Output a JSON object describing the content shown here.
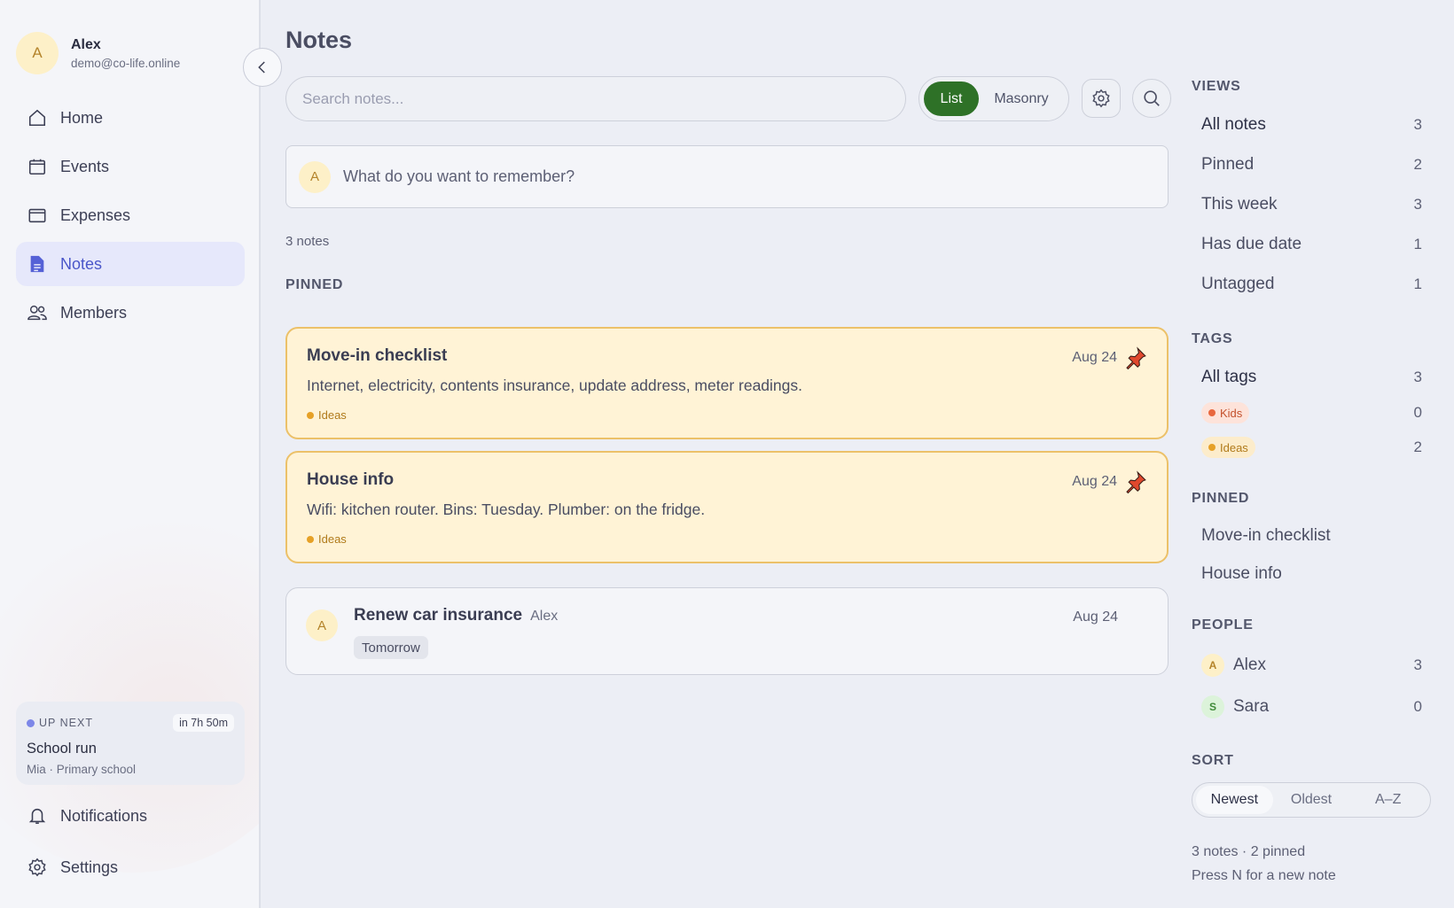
{
  "profile": {
    "initial": "A",
    "name": "Alex",
    "email": "demo@co-life.online"
  },
  "nav": {
    "items": [
      {
        "label": "Home",
        "icon": "home-icon"
      },
      {
        "label": "Events",
        "icon": "calendar-icon"
      },
      {
        "label": "Expenses",
        "icon": "wallet-icon"
      },
      {
        "label": "Notes",
        "icon": "note-icon",
        "active": true
      },
      {
        "label": "Members",
        "icon": "members-icon"
      }
    ],
    "bottom": [
      {
        "label": "Notifications",
        "icon": "bell-icon"
      },
      {
        "label": "Settings",
        "icon": "gear-icon"
      }
    ]
  },
  "up_next": {
    "label": "UP NEXT",
    "time": "in 7h 50m",
    "title": "School run",
    "subtitle": "Mia · Primary school"
  },
  "main": {
    "title": "Notes",
    "search_placeholder": "Search notes...",
    "view_toggle": {
      "active": "List",
      "inactive": "Masonry"
    },
    "composer": {
      "initial": "A",
      "placeholder": "What do you want to remember?"
    },
    "count_text": "3 notes",
    "pinned_label": "PINNED",
    "pinned_notes": [
      {
        "title": "Move-in checklist",
        "date": "Aug 24",
        "body": "Internet, electricity, contents insurance, update address, meter readings.",
        "tag": "Ideas"
      },
      {
        "title": "House info",
        "date": "Aug 24",
        "body": "Wifi: kitchen router. Bins: Tuesday. Plumber: on the fridge.",
        "tag": "Ideas"
      }
    ],
    "other_notes": [
      {
        "initial": "A",
        "title": "Renew car insurance",
        "author": "Alex",
        "date": "Aug 24",
        "chip": "Tomorrow"
      }
    ]
  },
  "rail": {
    "views_label": "VIEWS",
    "views": [
      {
        "label": "All notes",
        "count": "3",
        "active": true
      },
      {
        "label": "Pinned",
        "count": "2"
      },
      {
        "label": "This week",
        "count": "3"
      },
      {
        "label": "Has due date",
        "count": "1"
      },
      {
        "label": "Untagged",
        "count": "1"
      }
    ],
    "tags_label": "TAGS",
    "all_tags": {
      "label": "All tags",
      "count": "3"
    },
    "tags": [
      {
        "label": "Kids",
        "count": "0",
        "color": "#e8673e"
      },
      {
        "label": "Ideas",
        "count": "2",
        "color": "#e6a127"
      }
    ],
    "pinned_label": "PINNED",
    "pinned_links": [
      "Move-in checklist",
      "House info"
    ],
    "people_label": "PEOPLE",
    "people": [
      {
        "initial": "A",
        "name": "Alex",
        "count": "3"
      },
      {
        "initial": "S",
        "name": "Sara",
        "count": "0"
      }
    ],
    "sort_label": "SORT",
    "sort_options": [
      "Newest",
      "Oldest",
      "A–Z"
    ],
    "sort_active": "Newest",
    "footer_line1": "3 notes · 2 pinned",
    "footer_line2": "Press N for a new note"
  },
  "colors": {
    "accent_green": "#2e7127",
    "nav_active": "#4a56c9",
    "pinned_bg": "#fff3d6",
    "pinned_border": "#ecc169",
    "pin_red": "#e0482d"
  }
}
